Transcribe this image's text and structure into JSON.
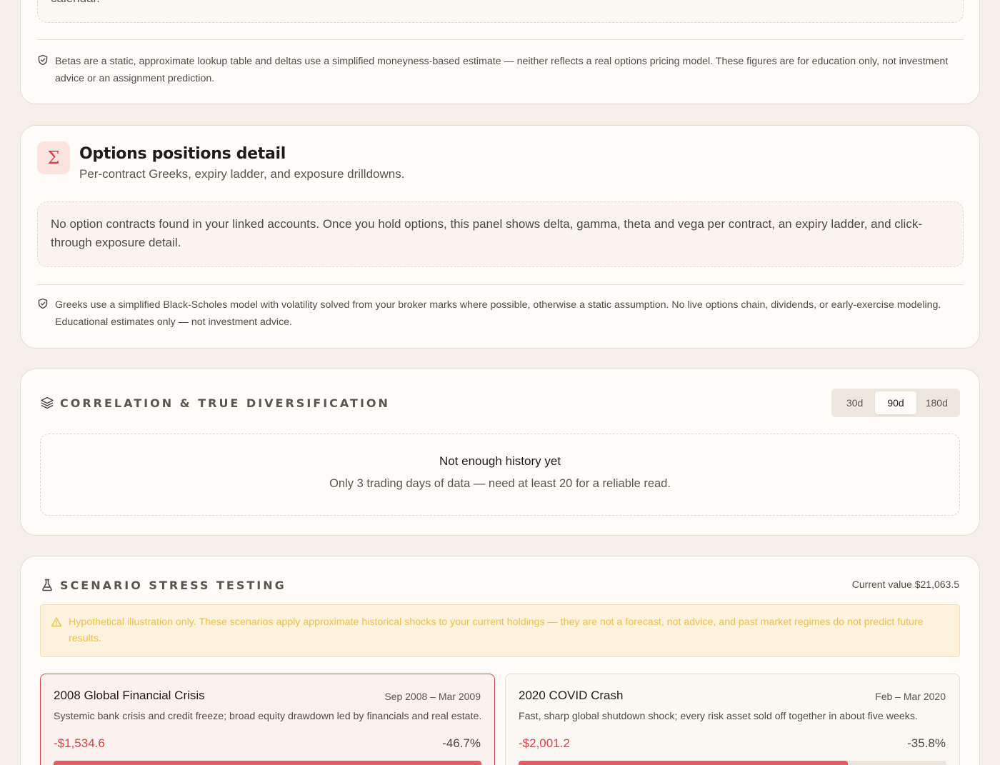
{
  "betas_card": {
    "empty_tail": "calendar.",
    "disclaimer": "Betas are a static, approximate lookup table and deltas use a simplified moneyness-based estimate — neither reflects a real options pricing model. These figures are for education only, not investment advice or an assignment prediction."
  },
  "options_card": {
    "icon": "sigma-icon",
    "icon_glyph": "Σ",
    "title": "Options positions detail",
    "subtitle": "Per-contract Greeks, expiry ladder, and exposure drilldowns.",
    "notice": "No option contracts found in your linked accounts. Once you hold options, this panel shows delta, gamma, theta and vega per contract, an expiry ladder, and click-through exposure detail.",
    "disclaimer": "Greeks use a simplified Black-Scholes model with volatility solved from your broker marks where possible, otherwise a static assumption. No live options chain, dividends, or early-exercise modeling. Educational estimates only — not investment advice."
  },
  "correlation_card": {
    "icon": "layers-icon",
    "title": "Correlation & true diversification",
    "ranges": [
      {
        "label": "30d",
        "active": false
      },
      {
        "label": "90d",
        "active": true
      },
      {
        "label": "180d",
        "active": false
      }
    ],
    "empty_title": "Not enough history yet",
    "empty_message": "Only 3 trading days of data — need at least 20 for a reliable read."
  },
  "stress_card": {
    "icon": "flask-icon",
    "title": "Scenario stress testing",
    "current_value": "Current value $21,063.5",
    "warning": "Hypothetical illustration only. These scenarios apply approximate historical shocks to your current holdings — they are not a forecast, not advice, and past market regimes do not predict future results.",
    "scenarios": [
      {
        "name": "2008 Global Financial Crisis",
        "period": "Sep 2008 – Mar 2009",
        "description": "Systemic bank crisis and credit freeze; broad equity drawdown led by financials and real estate.",
        "loss": "-$1,534.6",
        "pct": "-46.7%",
        "severity_fraction": 1.0
      },
      {
        "name": "2020 COVID Crash",
        "period": "Feb – Mar 2020",
        "description": "Fast, sharp global shutdown shock; every risk asset sold off together in about five weeks.",
        "loss": "-$2,001.2",
        "pct": "-35.8%",
        "severity_fraction": 0.77
      }
    ]
  },
  "colors": {
    "accent_red": "#d8424a",
    "warning_text": "#ecc14e",
    "page_bg": "#f5f1ea"
  }
}
